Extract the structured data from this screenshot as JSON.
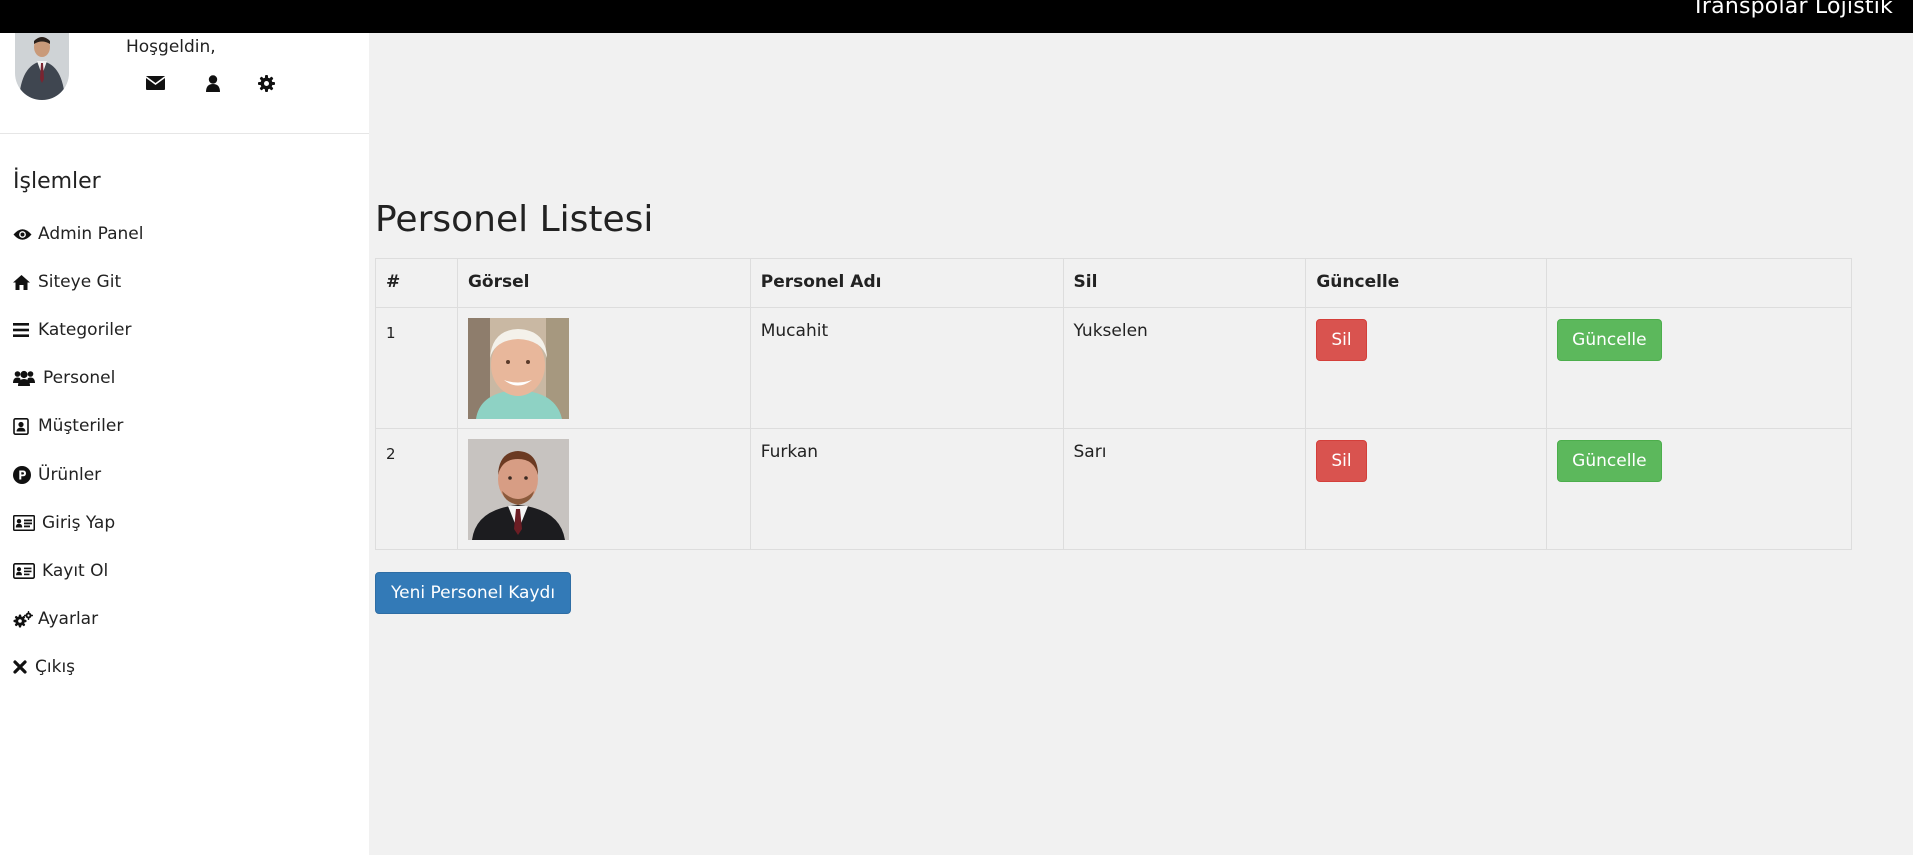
{
  "header": {
    "brand": "Transpolar Lojistik"
  },
  "user": {
    "welcome": "Hoşgeldin,",
    "icons": [
      "envelope-icon",
      "user-icon",
      "gear-icon"
    ]
  },
  "sidebar": {
    "title": "İşlemler",
    "items": [
      {
        "label": "Admin Panel",
        "icon": "eye-icon"
      },
      {
        "label": "Siteye Git",
        "icon": "home-icon"
      },
      {
        "label": "Kategoriler",
        "icon": "bars-icon"
      },
      {
        "label": "Personel",
        "icon": "users-icon"
      },
      {
        "label": "Müşteriler",
        "icon": "address-book-icon"
      },
      {
        "label": "Ürünler",
        "icon": "product-hunt-icon"
      },
      {
        "label": "Giriş Yap",
        "icon": "id-card-icon"
      },
      {
        "label": "Kayıt Ol",
        "icon": "id-card-outline-icon"
      },
      {
        "label": "Ayarlar",
        "icon": "gears-icon"
      },
      {
        "label": "Çıkış",
        "icon": "times-icon"
      }
    ]
  },
  "main": {
    "title": "Personel Listesi",
    "table": {
      "headers": [
        "#",
        "Görsel",
        "Personel Adı",
        "Sil",
        "Güncelle",
        ""
      ],
      "rows": [
        {
          "id": "1",
          "name": "Mucahit",
          "surname": "Yukselen",
          "delete_label": "Sil",
          "update_label": "Güncelle"
        },
        {
          "id": "2",
          "name": "Furkan",
          "surname": "Sarı",
          "delete_label": "Sil",
          "update_label": "Güncelle"
        }
      ]
    },
    "new_button": "Yeni Personel Kaydı"
  },
  "colors": {
    "danger": "#d9534f",
    "success": "#5cb85c",
    "primary": "#337ab7",
    "topbar": "#000000",
    "background": "#f1f1f1"
  }
}
